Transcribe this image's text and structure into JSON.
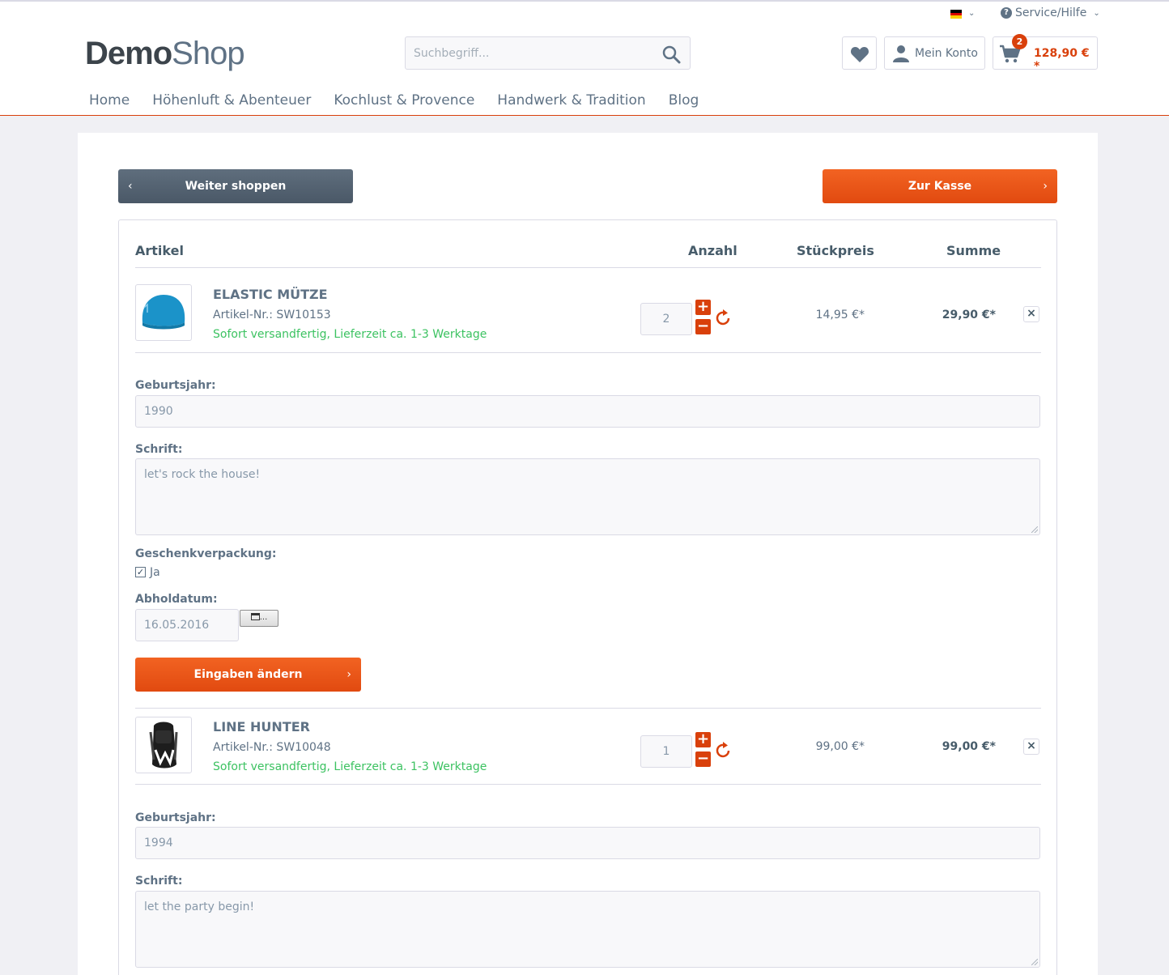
{
  "topbar": {
    "language": "DE",
    "service_label": "Service/Hilfe"
  },
  "header": {
    "logo_bold": "Demo",
    "logo_light": "Shop",
    "search_placeholder": "Suchbegriff...",
    "account_label": "Mein Konto",
    "cart_count": "2",
    "cart_amount": "128,90 € *"
  },
  "nav": [
    "Home",
    "Höhenluft & Abenteuer",
    "Kochlust & Provence",
    "Handwerk & Tradition",
    "Blog"
  ],
  "actions": {
    "continue_label": "Weiter shoppen",
    "checkout_label": "Zur Kasse"
  },
  "table_headers": {
    "article": "Artikel",
    "quantity": "Anzahl",
    "unit_price": "Stückpreis",
    "sum": "Summe"
  },
  "items": [
    {
      "name": "ELASTIC MÜTZE",
      "article_number": "Artikel-Nr.: SW10153",
      "delivery": "Sofort versandfertig, Lieferzeit ca. 1-3 Werktage",
      "quantity": "2",
      "unit_price": "14,95 €*",
      "total": "29,90 €*",
      "fields": {
        "birth_year_label": "Geburtsjahr:",
        "birth_year": "1990",
        "text_label": "Schrift:",
        "text": "let's rock the house!",
        "gift_label": "Geschenkverpackung:",
        "gift_option": "Ja",
        "gift_checked": true,
        "pickup_label": "Abholdatum:",
        "pickup_date": "16.05.2016",
        "calendar_button": "...",
        "submit_label": "Eingaben ändern"
      }
    },
    {
      "name": "LINE HUNTER",
      "article_number": "Artikel-Nr.: SW10048",
      "delivery": "Sofort versandfertig, Lieferzeit ca. 1-3 Werktage",
      "quantity": "1",
      "unit_price": "99,00 €*",
      "total": "99,00 €*",
      "fields": {
        "birth_year_label": "Geburtsjahr:",
        "birth_year": "1994",
        "text_label": "Schrift:",
        "text": "let the party begin!"
      }
    }
  ],
  "colors": {
    "accent": "#d9400b",
    "delivery_green": "#3cc261",
    "text": "#5f7285"
  }
}
